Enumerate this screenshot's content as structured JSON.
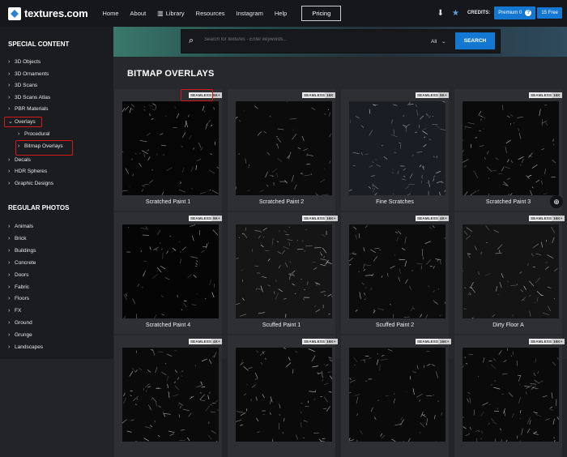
{
  "header": {
    "logo_text": "textures.com",
    "nav": [
      "Home",
      "About",
      "Library",
      "Resources",
      "Instagram",
      "Help"
    ],
    "pricing_label": "Pricing",
    "credits_label": "CREDITS:",
    "premium_label": "Premium 0",
    "free_label": "15 Free"
  },
  "sidebar": {
    "special_heading": "SPECIAL CONTENT",
    "special_items": [
      "3D Objects",
      "3D Ornaments",
      "3D Scans",
      "3D Scans Atlas",
      "PBR Materials",
      "Overlays",
      "Procedural",
      "Bitmap Overlays",
      "Decals",
      "HDR Spheres",
      "Graphic Designs"
    ],
    "regular_heading": "REGULAR PHOTOS",
    "regular_items": [
      "Animals",
      "Brick",
      "Buildings",
      "Concrete",
      "Doors",
      "Fabric",
      "Floors",
      "FX",
      "Ground",
      "Grunge",
      "Landscapes"
    ]
  },
  "search": {
    "placeholder": "Search for textures - Enter keywords...",
    "filter": "All",
    "button": "SEARCH"
  },
  "page_title": "BITMAP OVERLAYS",
  "tiles": [
    {
      "name": "Scratched Paint 1",
      "seamless": "SEAMLESS",
      "res": "8K+"
    },
    {
      "name": "Scratched Paint 2",
      "seamless": "SEAMLESS",
      "res": "16K"
    },
    {
      "name": "Fine Scratches",
      "seamless": "SEAMLESS",
      "res": "8K+"
    },
    {
      "name": "Scratched Paint 3",
      "seamless": "SEAMLESS",
      "res": "16K"
    },
    {
      "name": "Scratched Paint 4",
      "seamless": "SEAMLESS",
      "res": "8K+"
    },
    {
      "name": "Scuffed Paint 1",
      "seamless": "SEAMLESS",
      "res": "16K+"
    },
    {
      "name": "Scuffed Paint 2",
      "seamless": "SEAMLESS",
      "res": "4K+"
    },
    {
      "name": "Dirty Floor A",
      "seamless": "SEAMLESS",
      "res": "16K+"
    },
    {
      "name": "",
      "seamless": "SEAMLESS",
      "res": "4K+"
    },
    {
      "name": "",
      "seamless": "SEAMLESS",
      "res": "16K+"
    },
    {
      "name": "",
      "seamless": "SEAMLESS",
      "res": "16K+"
    },
    {
      "name": "",
      "seamless": "SEAMLESS",
      "res": "16K+"
    }
  ],
  "colors": {
    "accent": "#1477d1",
    "highlight": "#d21a1a"
  }
}
